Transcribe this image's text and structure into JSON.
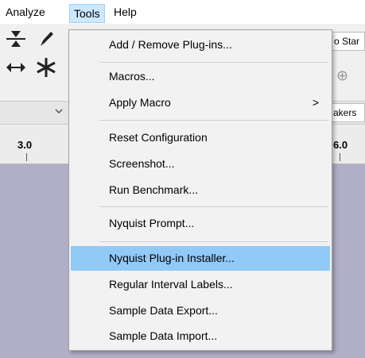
{
  "menubar": {
    "items": [
      {
        "label": "Analyze"
      },
      {
        "label": "Tools"
      },
      {
        "label": "Help"
      }
    ]
  },
  "toolbar": {
    "right_fragments": {
      "start_fragment": "o Star",
      "speakers_fragment": "akers"
    },
    "icons": {
      "zoom_toggle": "⇲",
      "draw_tool": "🖉",
      "time_shift": "↔",
      "multi_tool": "✱",
      "zoom_in": "⊕",
      "dropdown": "⌄"
    }
  },
  "ruler": {
    "labels": [
      "3.0",
      "6.0"
    ]
  },
  "tools_menu": {
    "items": [
      {
        "label": "Add / Remove Plug-ins..."
      },
      {
        "label": "Macros..."
      },
      {
        "label": "Apply Macro",
        "submenu": true
      },
      {
        "label": "Reset Configuration"
      },
      {
        "label": "Screenshot..."
      },
      {
        "label": "Run Benchmark..."
      },
      {
        "label": "Nyquist Prompt..."
      },
      {
        "label": "Nyquist Plug-in Installer...",
        "highlighted": true
      },
      {
        "label": "Regular Interval Labels..."
      },
      {
        "label": "Sample Data Export..."
      },
      {
        "label": "Sample Data Import..."
      }
    ],
    "submenu_arrow": ">"
  },
  "colors": {
    "highlight": "#91c9f7",
    "menubar_active": "#cce8ff",
    "track_background": "#b0afc7"
  }
}
